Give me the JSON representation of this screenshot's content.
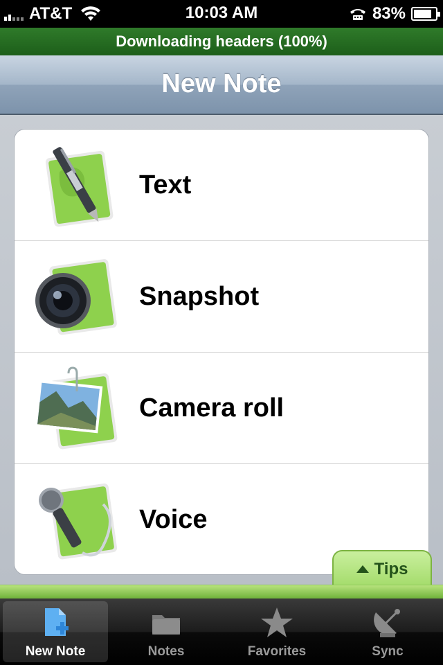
{
  "status_bar": {
    "carrier": "AT&T",
    "time": "10:03 AM",
    "battery": "83%",
    "battery_level": 0.83
  },
  "banner": {
    "text": "Downloading headers (100%)"
  },
  "nav": {
    "title": "New Note"
  },
  "menu": {
    "items": [
      {
        "label": "Text",
        "icon": "pen-note-icon"
      },
      {
        "label": "Snapshot",
        "icon": "camera-lens-note-icon"
      },
      {
        "label": "Camera roll",
        "icon": "photo-clip-note-icon"
      },
      {
        "label": "Voice",
        "icon": "microphone-note-icon"
      }
    ]
  },
  "tips": {
    "label": "Tips"
  },
  "tab_bar": {
    "tabs": [
      {
        "label": "New Note",
        "icon": "new-note-icon",
        "active": true
      },
      {
        "label": "Notes",
        "icon": "folder-icon",
        "active": false
      },
      {
        "label": "Favorites",
        "icon": "star-icon",
        "active": false
      },
      {
        "label": "Sync",
        "icon": "satellite-dish-icon",
        "active": false
      }
    ]
  },
  "colors": {
    "banner_green": "#1d5f1a",
    "accent_green": "#8cc63f",
    "tab_active_blue": "#3a9be8"
  }
}
